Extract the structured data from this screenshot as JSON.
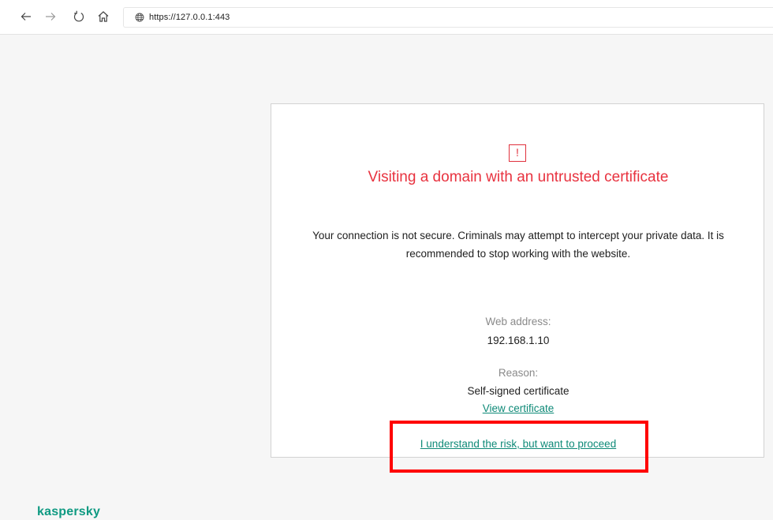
{
  "browser": {
    "url": "https://127.0.0.1:443",
    "icons": [
      "back-arrow-icon",
      "forward-arrow-icon",
      "refresh-icon",
      "home-icon",
      "globe-icon"
    ]
  },
  "warning": {
    "icon_symbol": "!",
    "title": "Visiting a domain with an untrusted certificate",
    "message": "Your connection is not secure. Criminals may attempt to intercept your private data. It is recommended to stop working with the website.",
    "web_address_label": "Web address:",
    "web_address_value": "192.168.1.10",
    "reason_label": "Reason:",
    "reason_value": "Self-signed certificate",
    "view_certificate_link": "View certificate",
    "proceed_link": "I understand the risk, but want to proceed",
    "accent_color": "#e8323f",
    "link_color": "#0f8a78"
  },
  "footer": {
    "brand": "kaspersky",
    "brand_color": "#0f9a82"
  },
  "annotation": {
    "highlight_color": "#ff0000"
  }
}
